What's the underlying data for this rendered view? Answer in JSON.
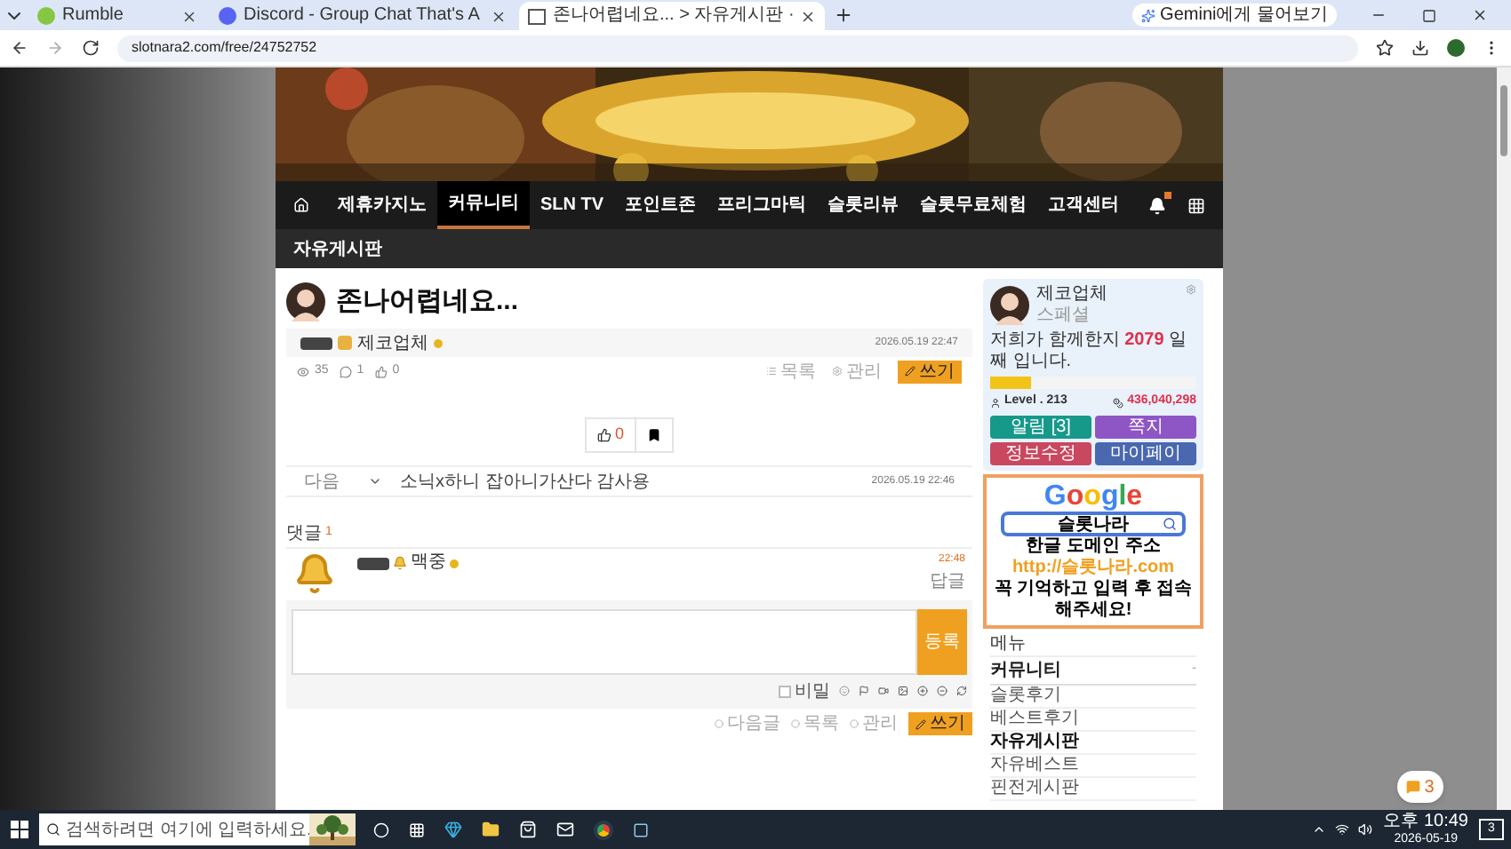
{
  "browser": {
    "tabs": [
      {
        "title": "Rumble",
        "kind": "rumble",
        "selected": false
      },
      {
        "title": "Discord - Group Chat That's A",
        "kind": "discord",
        "selected": false
      },
      {
        "title": "존나어렵네요... > 자유게시판 ·",
        "kind": "page",
        "selected": true
      }
    ],
    "gemini_button": "Gemini에게 물어보기",
    "url": "slotnara2.com/free/24752752"
  },
  "nav": {
    "items": [
      {
        "label": "제휴카지노",
        "selected": false
      },
      {
        "label": "커뮤니티",
        "selected": true
      },
      {
        "label": "SLN TV",
        "selected": false
      },
      {
        "label": "포인트존",
        "selected": false
      },
      {
        "label": "프리그마틱",
        "selected": false
      },
      {
        "label": "슬롯리뷰",
        "selected": false
      },
      {
        "label": "슬롯무료체험",
        "selected": false
      },
      {
        "label": "고객센터",
        "selected": false
      }
    ]
  },
  "breadcrumb": "자유게시판",
  "post": {
    "title": "존나어렵네요...",
    "author": "제코업체",
    "date": "2026.05.19 22:47",
    "views": "35",
    "comments": "1",
    "likes": "0",
    "actions": [
      "목록",
      "관리",
      "쓰기"
    ],
    "like_count": "0",
    "next": {
      "label": "다음",
      "title": "소닉x하니 잡아니가산다 감사용",
      "date": "2026.05.19 22:46"
    }
  },
  "comments": {
    "header": "댓글",
    "count": "1",
    "items": [
      {
        "author": "맥중",
        "time": "22:48",
        "reply": "답글"
      }
    ],
    "submit": "등록",
    "secret": {
      "label": "비밀",
      "checked": false
    },
    "bottom_actions": [
      "다음글",
      "목록",
      "관리",
      "쓰기"
    ]
  },
  "profile": {
    "name": "제코업체",
    "rank": "스페셜",
    "message_before": "저희가 함께한지 ",
    "days": "2079",
    "message_after": " 일째 입니다.",
    "level": 0.2,
    "level_text": "Level . 213",
    "points": "436,040,298",
    "buttons": [
      {
        "label": "알림 [3]",
        "color": "#17998a"
      },
      {
        "label": "쪽지",
        "color": "#8e55c4"
      },
      {
        "label": "정보수정",
        "color": "#c9485f"
      },
      {
        "label": "마이페이",
        "color": "#4a68b0"
      }
    ]
  },
  "ad": {
    "logo": "Google",
    "search": "슬롯나라",
    "line1": "한글 도메인 주소",
    "line2": "http://슬롯나라.com",
    "line3": "꼭 기억하고 입력 후 접속 해주세요!"
  },
  "menu": {
    "title": "메뉴",
    "section": "커뮤니티",
    "toggle": "-",
    "items": [
      {
        "label": "슬롯후기",
        "selected": false
      },
      {
        "label": "베스트후기",
        "selected": false
      },
      {
        "label": "자유게시판",
        "selected": true
      },
      {
        "label": "자유베스트",
        "selected": false
      },
      {
        "label": "핀전게시판",
        "selected": false
      }
    ]
  },
  "chat_badge": "3",
  "taskbar": {
    "search_placeholder": "검색하려면 여기에 입력하세요.",
    "time": "오후 10:49",
    "date": "2026-05-19",
    "notifications": "3"
  }
}
